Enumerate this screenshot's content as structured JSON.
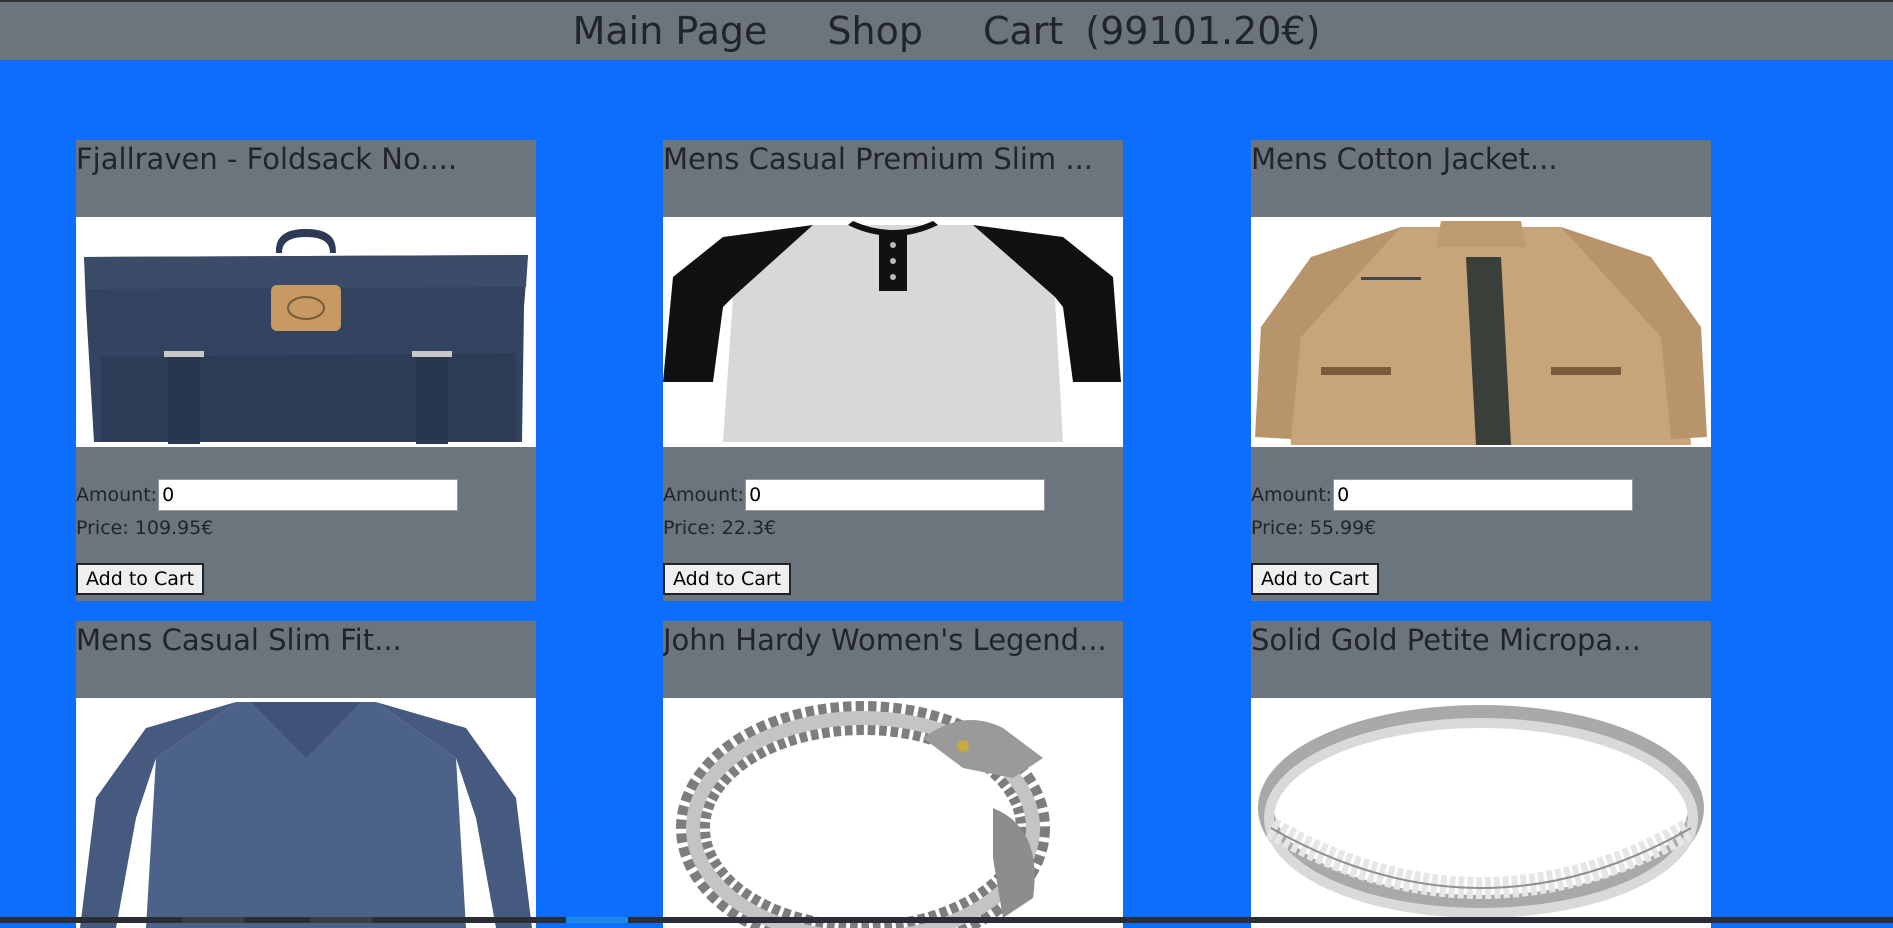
{
  "nav": {
    "main_page": "Main Page",
    "shop": "Shop",
    "cart": "Cart",
    "cart_total": "(99101.20€)"
  },
  "labels": {
    "amount": "Amount:",
    "add_to_cart": "Add to Cart"
  },
  "colors": {
    "background": "#0d6efd",
    "card": "#6c757d",
    "topbar": "#6c757d"
  },
  "products": [
    {
      "title": "Fjallraven - Foldsack No....",
      "amount": "0",
      "price": "Price: 109.95€",
      "image": "backpack-image"
    },
    {
      "title": "Mens Casual Premium Slim ...",
      "amount": "0",
      "price": "Price: 22.3€",
      "image": "raglan-tshirt-image"
    },
    {
      "title": "Mens Cotton Jacket...",
      "amount": "0",
      "price": "Price: 55.99€",
      "image": "cotton-jacket-image"
    },
    {
      "title": "Mens Casual Slim Fit...",
      "image": "longsleeve-shirt-image"
    },
    {
      "title": "John Hardy Women's Legend...",
      "image": "dragon-bracelet-image"
    },
    {
      "title": "Solid Gold Petite Micropa...",
      "image": "diamond-ring-image"
    }
  ]
}
